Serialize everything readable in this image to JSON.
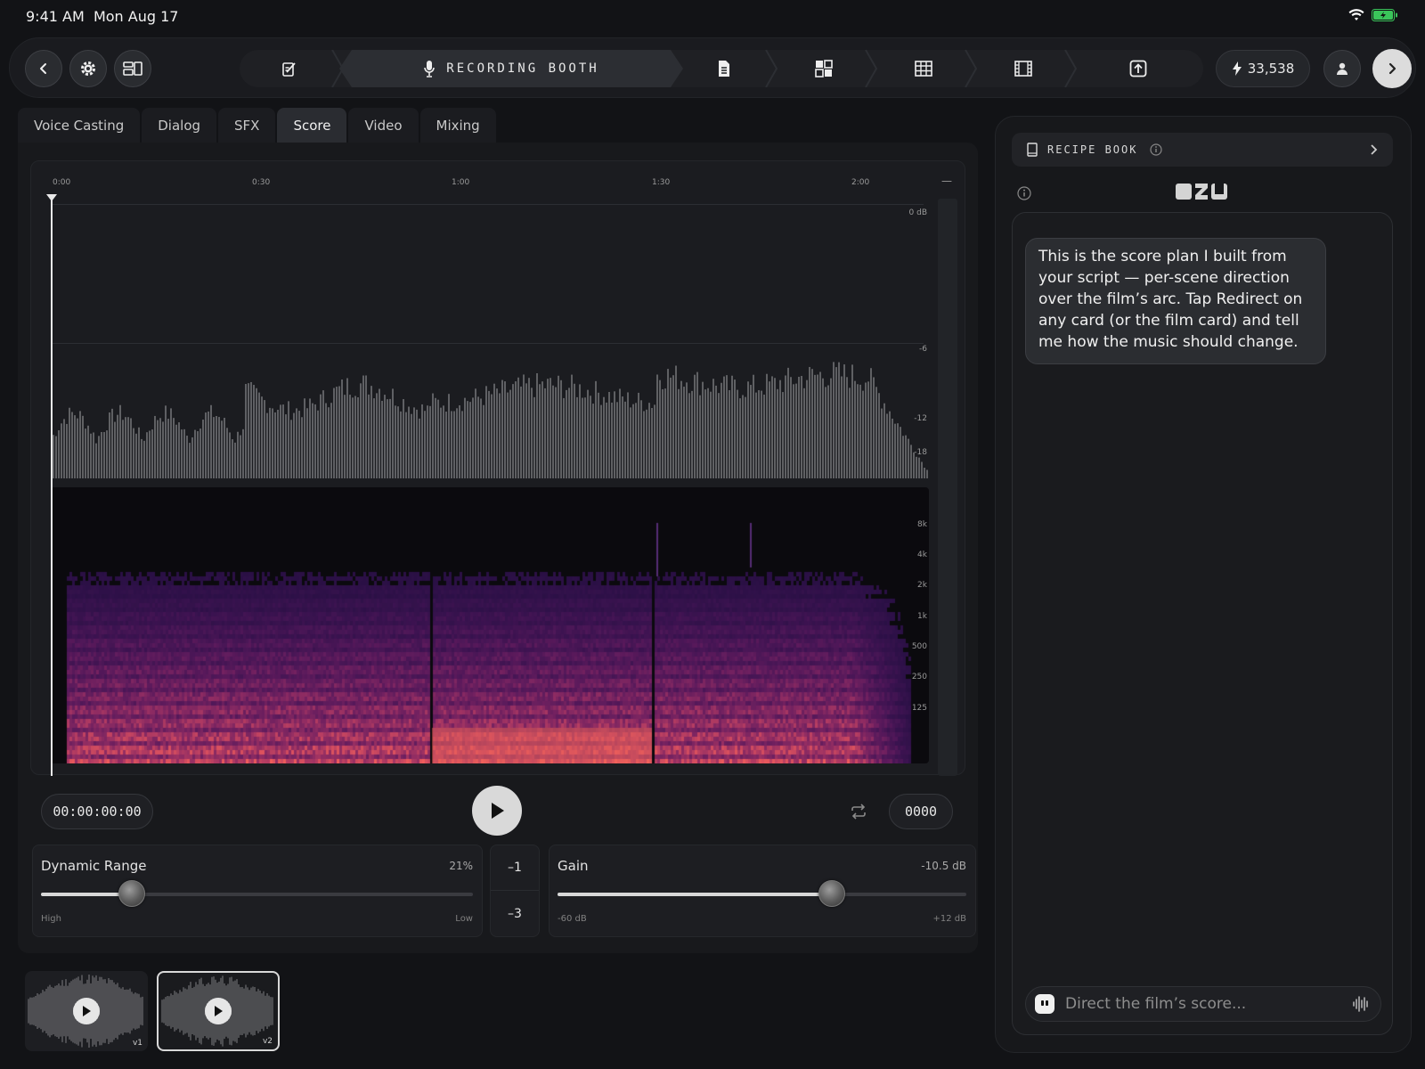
{
  "status_bar": {
    "time": "9:41 AM",
    "date": "Mon Aug 17"
  },
  "toolbar": {
    "pipeline_active_label": "RECORDING BOOTH",
    "credits": "33,538"
  },
  "tabs": [
    {
      "label": "Voice Casting",
      "active": false
    },
    {
      "label": "Dialog",
      "active": false
    },
    {
      "label": "SFX",
      "active": false
    },
    {
      "label": "Score",
      "active": true
    },
    {
      "label": "Video",
      "active": false
    },
    {
      "label": "Mixing",
      "active": false
    }
  ],
  "timeline": {
    "ticks": [
      "0:00",
      "0:30",
      "1:00",
      "1:30",
      "2:00"
    ],
    "end_marker": "—"
  },
  "waveform": {
    "db_labels": [
      "0 dB",
      "-6",
      "-12",
      "-18"
    ]
  },
  "spectrogram": {
    "freq_labels": [
      "8k",
      "4k",
      "2k",
      "1k",
      "500",
      "250",
      "125"
    ]
  },
  "transport": {
    "timecode": "00:00:00:00",
    "counter": "0000"
  },
  "controls": {
    "dynamic_range": {
      "title": "Dynamic Range",
      "value": "21%",
      "min_label": "High",
      "max_label": "Low",
      "level": 0.21
    },
    "steps": [
      "–1",
      "–3"
    ],
    "gain": {
      "title": "Gain",
      "value": "-10.5 dB",
      "min_label": "-60 dB",
      "max_label": "+12 dB",
      "level": 0.67
    }
  },
  "versions": [
    {
      "label": "v1",
      "selected": false
    },
    {
      "label": "v2",
      "selected": true
    }
  ],
  "right_panel": {
    "recipe_title": "RECIPE BOOK",
    "assistant_message": "This is the score plan I built from your script — per-scene direction over the film’s arc. Tap Redirect on any card (or the film card) and tell me how the music should change.",
    "input_placeholder": "Direct the film’s score..."
  },
  "colors": {
    "accent_light": "#d9d9d9",
    "background": "#121316",
    "spectrogram_low": "#ee5e5e",
    "spectrogram_high": "#8a3fd0"
  }
}
